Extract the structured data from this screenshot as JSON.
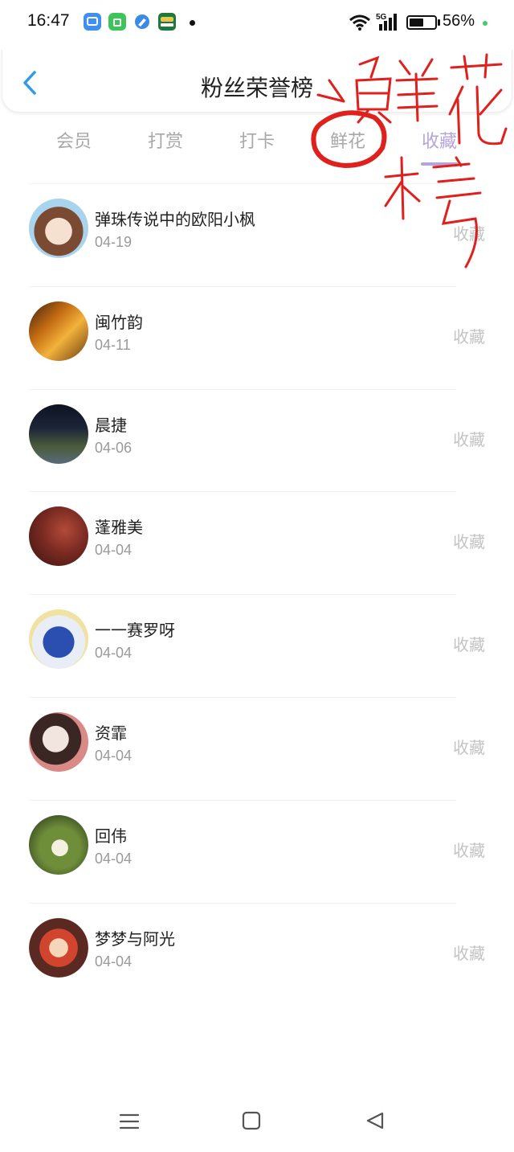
{
  "status_bar": {
    "time": "16:47",
    "network": "5G",
    "battery_percent": "56%",
    "battery_level": 0.56,
    "icons": [
      "files-app-icon",
      "shop-app-icon",
      "browser-app-icon",
      "bank-app-icon",
      "notification-dot",
      "wifi-icon",
      "5g-signal-icon",
      "battery-icon"
    ]
  },
  "header": {
    "title": "粉丝荣誉榜",
    "back_icon": "chevron-left-icon",
    "accent_color": "#2f9be6"
  },
  "tabs": [
    {
      "label": "会员",
      "active": false
    },
    {
      "label": "打赏",
      "active": false
    },
    {
      "label": "打卡",
      "active": false
    },
    {
      "label": "鲜花",
      "active": false
    },
    {
      "label": "收藏",
      "active": true
    }
  ],
  "active_tab_color": "#b5a3de",
  "fans": [
    {
      "name": "弹珠传说中的欧阳小枫",
      "date": "04-19",
      "action": "收藏"
    },
    {
      "name": "闽竹韵",
      "date": "04-11",
      "action": "收藏"
    },
    {
      "name": "晨捷",
      "date": "04-06",
      "action": "收藏"
    },
    {
      "name": "蓬雅美",
      "date": "04-04",
      "action": "收藏"
    },
    {
      "name": "一一赛罗呀",
      "date": "04-04",
      "action": "收藏"
    },
    {
      "name": "资霏",
      "date": "04-04",
      "action": "收藏"
    },
    {
      "name": "回伟",
      "date": "04-04",
      "action": "收藏"
    },
    {
      "name": "梦梦与阿光",
      "date": "04-04",
      "action": "收藏"
    }
  ],
  "nav_bar": {
    "icons": [
      "menu-icon",
      "home-icon",
      "back-triangle-icon"
    ]
  },
  "annotation": {
    "text": "鲜花",
    "color": "#e0201c"
  }
}
